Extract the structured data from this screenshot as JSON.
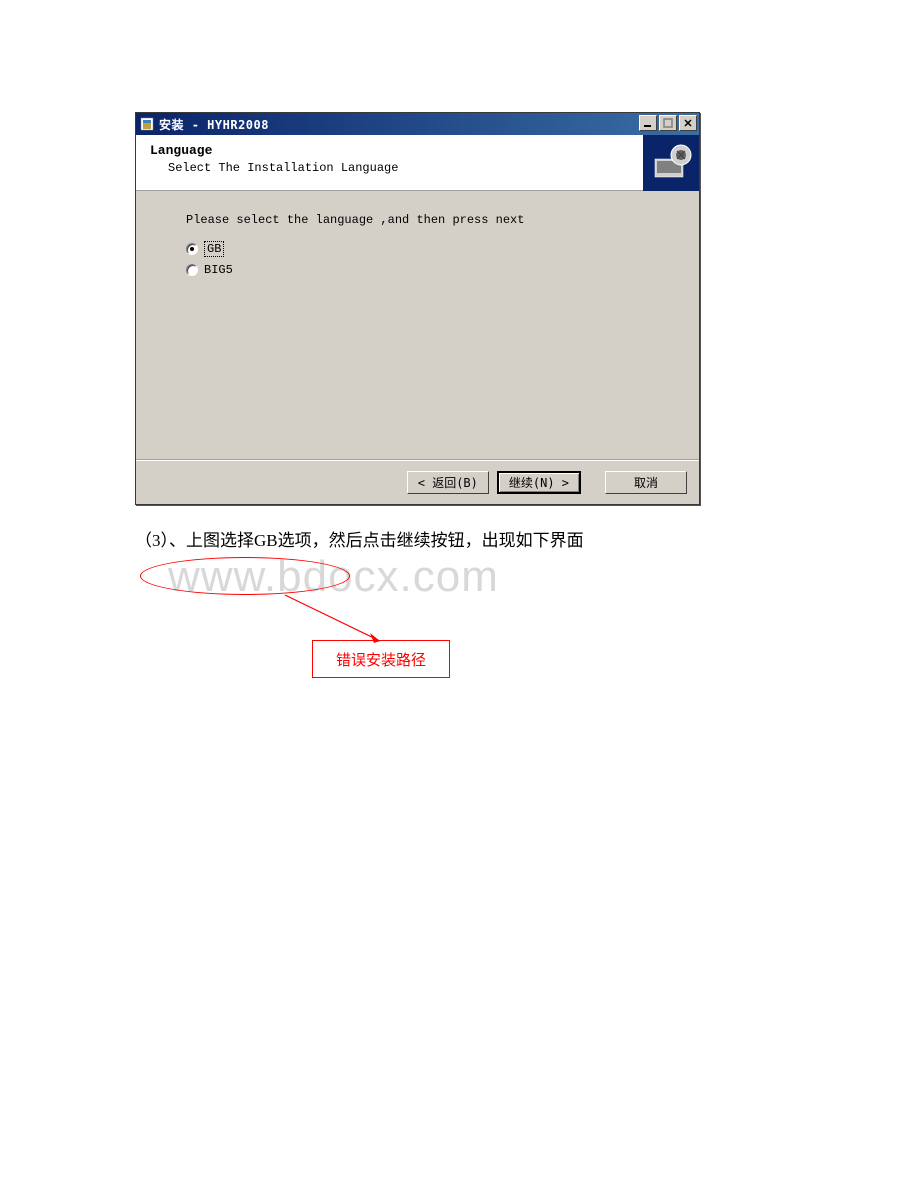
{
  "dialog": {
    "title": "安装 - HYHR2008",
    "header_title": "Language",
    "header_subtitle": "Select The Installation Language",
    "instruction": "Please select the language ,and then press next",
    "options": [
      {
        "label": "GB",
        "selected": true
      },
      {
        "label": "BIG5",
        "selected": false
      }
    ],
    "buttons": {
      "back": "< 返回(B)",
      "next": "继续(N) >",
      "cancel": "取消"
    }
  },
  "caption": "（3）、上图选择GB选项，然后点击继续按钮，出现如下界面",
  "watermark": "www.bdocx.com",
  "annotation": {
    "box_label": "错误安装路径"
  }
}
